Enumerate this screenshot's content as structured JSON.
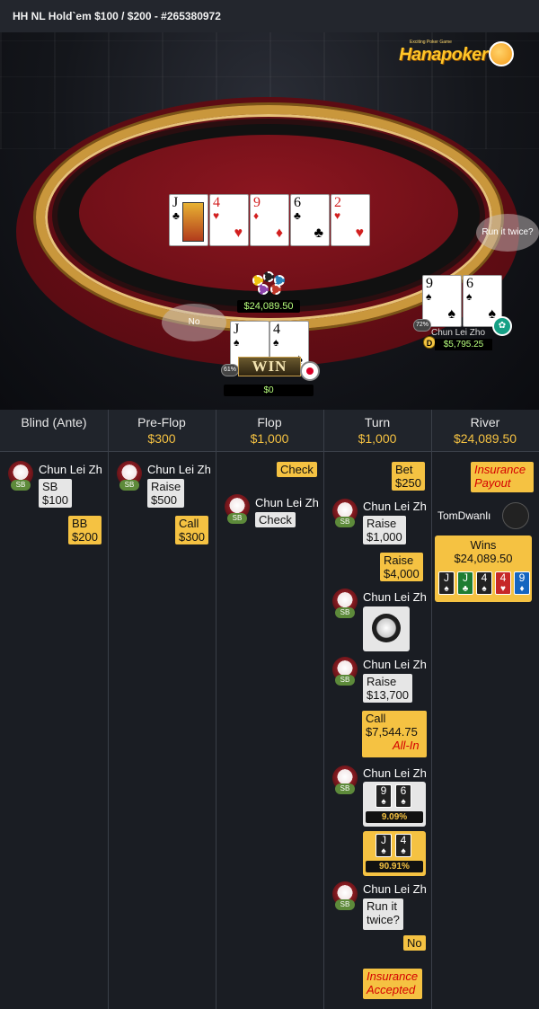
{
  "window": {
    "title": "HH NL Hold`em $100 / $200 - #265380972"
  },
  "logo": {
    "text": "Hanapoker",
    "tagline": "Exciting Poker Game"
  },
  "table": {
    "board": [
      {
        "rank": "J",
        "suit": "♣",
        "color": "black"
      },
      {
        "rank": "4",
        "suit": "♥",
        "color": "red"
      },
      {
        "rank": "9",
        "suit": "♦",
        "color": "red"
      },
      {
        "rank": "6",
        "suit": "♣",
        "color": "black"
      },
      {
        "rank": "2",
        "suit": "♥",
        "color": "red"
      }
    ],
    "pot": "$24,089.50",
    "hero": {
      "cards": [
        {
          "rank": "J",
          "suit": "♠"
        },
        {
          "rank": "4",
          "suit": "♠"
        }
      ],
      "equity": "61%",
      "result": "WIN",
      "stack": "$0",
      "bubble": "No"
    },
    "villain": {
      "name": "Chun Lei Zho",
      "cards": [
        {
          "rank": "9",
          "suit": "♠"
        },
        {
          "rank": "6",
          "suit": "♠"
        }
      ],
      "equity": "72%",
      "stack": "$5,795.25",
      "dealer": "D",
      "bubble": "Run it twice?"
    }
  },
  "columns": [
    {
      "label": "Blind (Ante)",
      "amount": ""
    },
    {
      "label": "Pre-Flop",
      "amount": "$300"
    },
    {
      "label": "Flop",
      "amount": "$1,000"
    },
    {
      "label": "Turn",
      "amount": "$1,000"
    },
    {
      "label": "River",
      "amount": "$24,089.50"
    }
  ],
  "player_name": "Chun Lei Zh",
  "sb": "SB",
  "blind": {
    "sb_action": "SB",
    "sb_amount": "$100",
    "bb_action": "BB",
    "bb_amount": "$200"
  },
  "preflop": {
    "raise": "Raise",
    "raise_amt": "$500",
    "call": "Call",
    "call_amt": "$300"
  },
  "flop": {
    "check_opp": "Check",
    "check_player": "Check"
  },
  "turn": {
    "bet": "Bet",
    "bet_amt": "$250",
    "raise1": "Raise",
    "raise1_amt": "$1,000",
    "raise2": "Raise",
    "raise2_amt": "$4,000",
    "raise3": "Raise",
    "raise3_amt": "$13,700",
    "call": "Call",
    "call_amt": "$7,544.75",
    "allin": "All-In",
    "villain_hand": [
      {
        "rank": "9",
        "suit": "♠"
      },
      {
        "rank": "6",
        "suit": "♠"
      }
    ],
    "villain_pct": "9.09%",
    "hero_hand": [
      {
        "rank": "J",
        "suit": "♠"
      },
      {
        "rank": "4",
        "suit": "♠"
      }
    ],
    "hero_pct": "90.91%",
    "run_it": "Run it twice?",
    "no": "No",
    "insurance": "Insurance Accepted"
  },
  "river": {
    "insurance_payout": "Insurance Payout",
    "winner": "TomDwanlı",
    "wins": "Wins",
    "wins_amt": "$24,089.50",
    "final_hand": [
      {
        "rank": "J",
        "suit": "♠",
        "bg": "#222222"
      },
      {
        "rank": "J",
        "suit": "♣",
        "bg": "#1e7d32"
      },
      {
        "rank": "4",
        "suit": "♠",
        "bg": "#222222"
      },
      {
        "rank": "4",
        "suit": "♥",
        "bg": "#c62828"
      },
      {
        "rank": "9",
        "suit": "♦",
        "bg": "#1565c0"
      }
    ]
  },
  "colors": {
    "accent": "#f5c242",
    "panel": "#1a1d23",
    "felt": "#6d0f17"
  }
}
